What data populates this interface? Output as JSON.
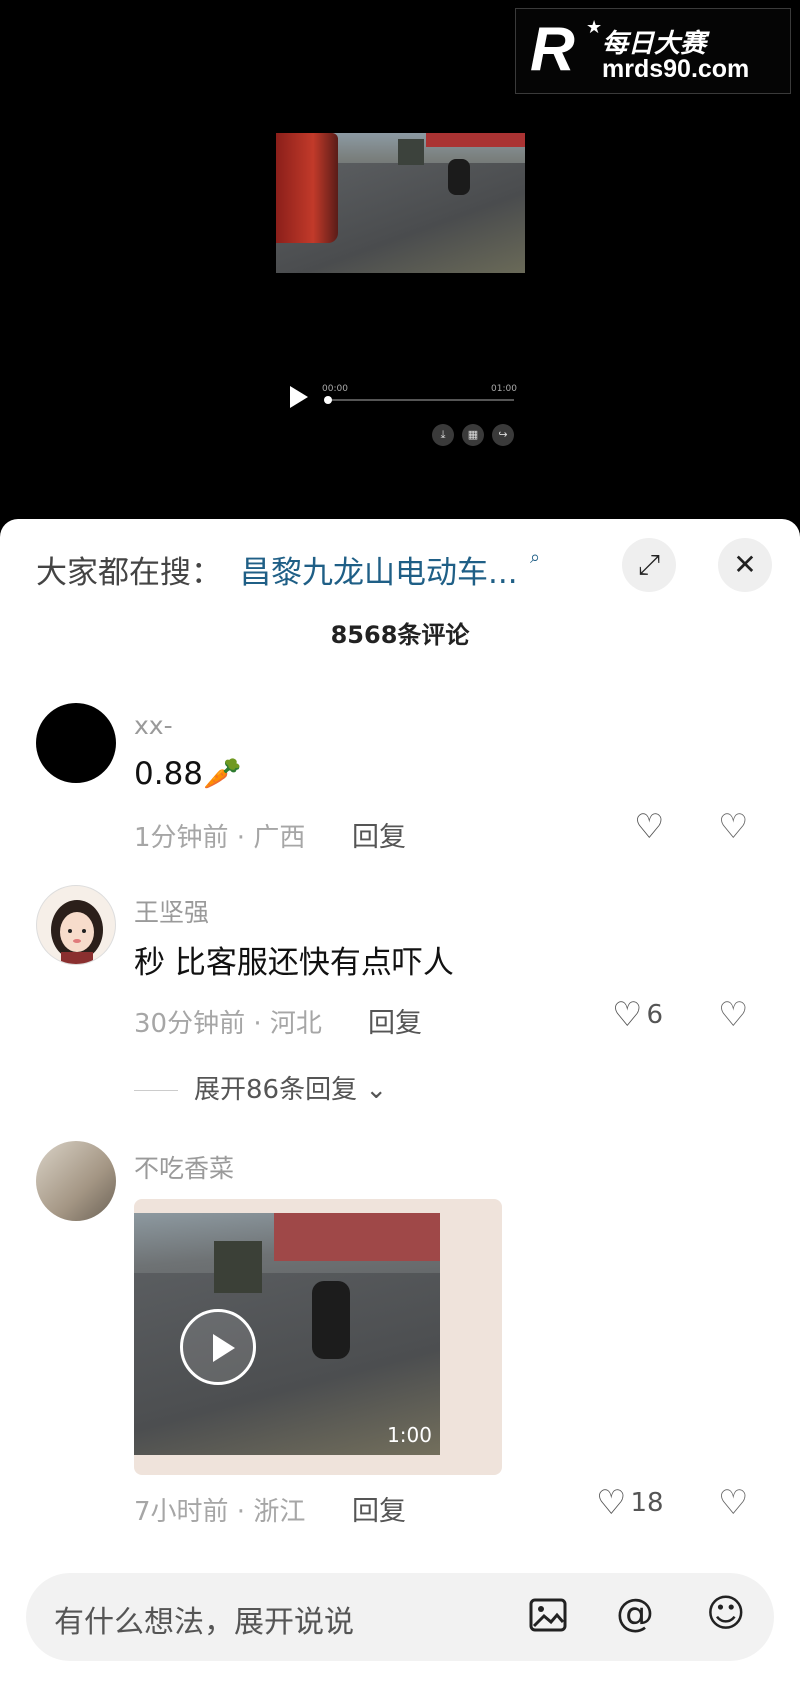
{
  "watermark": {
    "mark": "R",
    "name": "每日大赛",
    "url": "mrds90.com"
  },
  "player": {
    "time_current": "00:00",
    "time_total": "01:00",
    "progress": 0
  },
  "sheet": {
    "search_label": "大家都在搜：",
    "search_query": "昌黎九龙山电动车...",
    "comment_count": "8568条评论"
  },
  "comments": [
    {
      "user": "xx-",
      "text": "0.88🥕",
      "time_loc": "1分钟前 · 广西",
      "reply": "回复",
      "likes": ""
    },
    {
      "user": "王坚强",
      "text": "秒 比客服还快有点吓人",
      "time_loc": "30分钟前 · 河北",
      "reply": "回复",
      "likes": "6",
      "expand": "展开86条回复"
    },
    {
      "user": "不吃香菜",
      "time_loc": "7小时前 · 浙江",
      "reply": "回复",
      "likes": "18",
      "video_duration": "1:00"
    }
  ],
  "input": {
    "placeholder": "有什么想法，展开说说"
  },
  "icons": {
    "fullscreen": "fullscreen-icon",
    "close": "close-icon",
    "search": "search-icon",
    "heart": "heart-icon",
    "broken_heart": "dislike-icon",
    "image": "image-icon",
    "mention": "at-icon",
    "emoji": "emoji-icon"
  },
  "colors": {
    "link": "#1f5f86",
    "sheet_bg": "#ffffff",
    "input_bg": "#f2f2f2"
  }
}
